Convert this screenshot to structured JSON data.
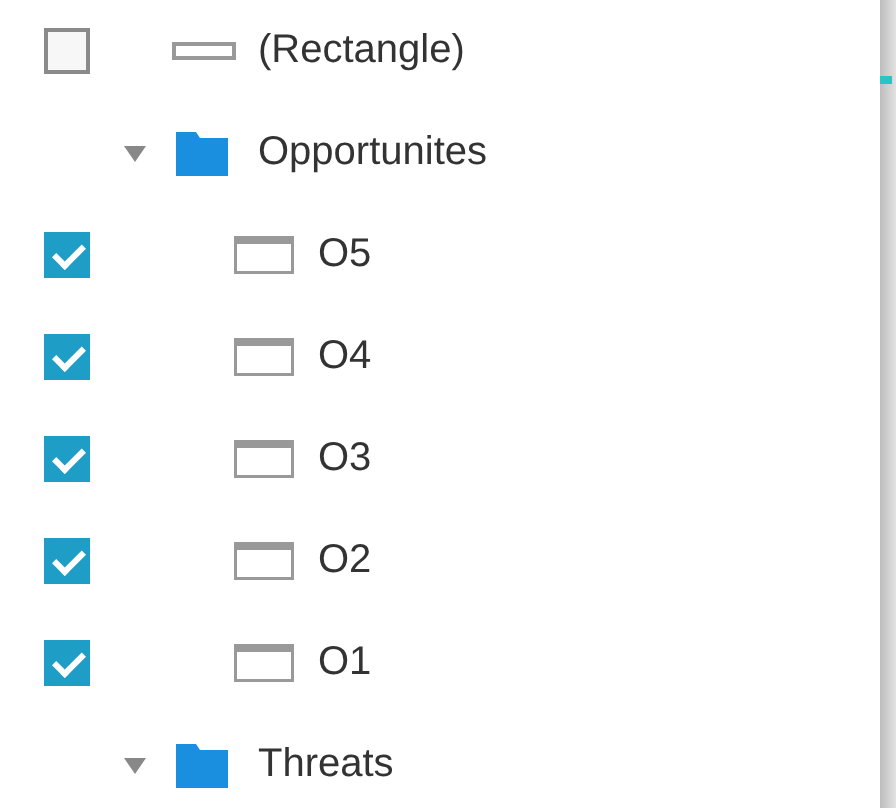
{
  "layers": [
    {
      "kind": "shape",
      "label": "(Rectangle)",
      "checked": false
    },
    {
      "kind": "folder",
      "label": "Opportunites",
      "expanded": true,
      "children": [
        {
          "kind": "frame",
          "label": "O5",
          "checked": true
        },
        {
          "kind": "frame",
          "label": "O4",
          "checked": true
        },
        {
          "kind": "frame",
          "label": "O3",
          "checked": true
        },
        {
          "kind": "frame",
          "label": "O2",
          "checked": true
        },
        {
          "kind": "frame",
          "label": "O1",
          "checked": true
        }
      ]
    },
    {
      "kind": "folder",
      "label": "Threats",
      "expanded": true
    }
  ]
}
